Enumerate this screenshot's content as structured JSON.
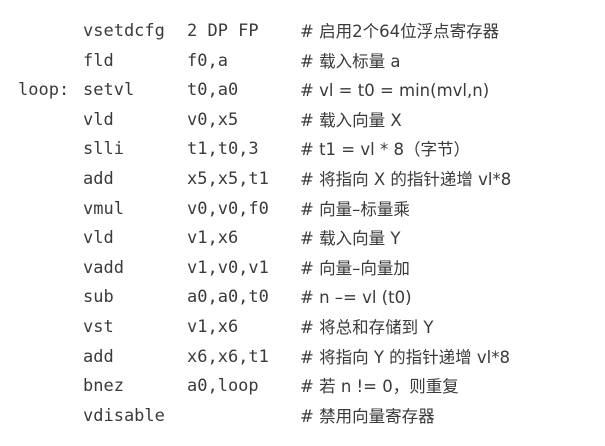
{
  "code_lines": [
    {
      "label": "",
      "mnemonic": "vsetdcfg",
      "operands": "2 DP FP",
      "comment": "# 启用2个64位浮点寄存器"
    },
    {
      "label": "",
      "mnemonic": "fld",
      "operands": "f0,a",
      "comment": "# 载入标量 a"
    },
    {
      "label": "loop:",
      "mnemonic": "setvl",
      "operands": "t0,a0",
      "comment": "# vl = t0 = min(mvl,n)"
    },
    {
      "label": "",
      "mnemonic": "vld",
      "operands": "v0,x5",
      "comment": "# 载入向量 X"
    },
    {
      "label": "",
      "mnemonic": "slli",
      "operands": "t1,t0,3",
      "comment": "# t1 = vl * 8（字节）"
    },
    {
      "label": "",
      "mnemonic": "add",
      "operands": "x5,x5,t1",
      "comment": "# 将指向 X 的指针递增 vl*8"
    },
    {
      "label": "",
      "mnemonic": "vmul",
      "operands": "v0,v0,f0",
      "comment": "# 向量–标量乘"
    },
    {
      "label": "",
      "mnemonic": "vld",
      "operands": "v1,x6",
      "comment": "# 载入向量 Y"
    },
    {
      "label": "",
      "mnemonic": "vadd",
      "operands": "v1,v0,v1",
      "comment": "# 向量–向量加"
    },
    {
      "label": "",
      "mnemonic": "sub",
      "operands": "a0,a0,t0",
      "comment": "# n –= vl (t0)"
    },
    {
      "label": "",
      "mnemonic": "vst",
      "operands": "v1,x6",
      "comment": "# 将总和存储到 Y"
    },
    {
      "label": "",
      "mnemonic": "add",
      "operands": "x6,x6,t1",
      "comment": "# 将指向 Y 的指针递增 vl*8"
    },
    {
      "label": "",
      "mnemonic": "bnez",
      "operands": "a0,loop",
      "comment": "# 若 n != 0，则重复"
    },
    {
      "label": "",
      "mnemonic": "vdisable",
      "operands": "",
      "comment": "# 禁用向量寄存器"
    }
  ]
}
